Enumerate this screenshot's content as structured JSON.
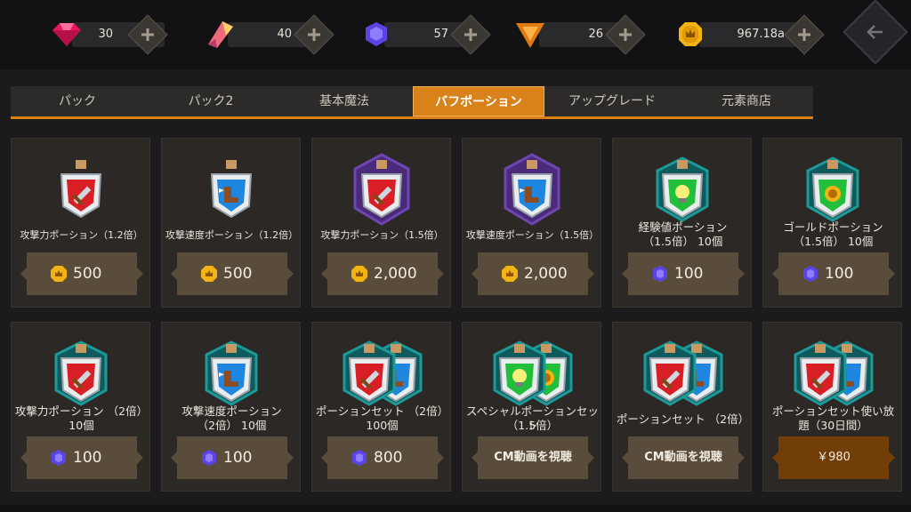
{
  "currencies": [
    {
      "icon": "ruby-gem-icon",
      "value": "30"
    },
    {
      "icon": "pink-crystal-icon",
      "value": "40"
    },
    {
      "icon": "purple-gem-icon",
      "value": "57"
    },
    {
      "icon": "orange-triangle-gem-icon",
      "value": "26"
    },
    {
      "icon": "gold-coin-icon",
      "value": "967.18a"
    }
  ],
  "tabs": [
    {
      "label": "パック",
      "active": false
    },
    {
      "label": "パック2",
      "active": false
    },
    {
      "label": "基本魔法",
      "active": false
    },
    {
      "label": "バフポーション",
      "active": true
    },
    {
      "label": "アップグレード",
      "active": false
    },
    {
      "label": "元素商店",
      "active": false
    }
  ],
  "colors": {
    "accent": "#d8821a",
    "card": "#2b2825",
    "button": "#594c3b",
    "buy_button": "#713e07"
  },
  "cards": [
    {
      "name_lines": [
        "攻撃力ポーション（1.2倍）"
      ],
      "potions": "sword-red",
      "frame": "none",
      "price_icon": "gold-coin-icon",
      "price": "500"
    },
    {
      "name_lines": [
        "攻撃速度ポーション（1.2倍）"
      ],
      "potions": "boot-blue",
      "frame": "none",
      "price_icon": "gold-coin-icon",
      "price": "500"
    },
    {
      "name_lines": [
        "攻撃力ポーション（1.5倍）"
      ],
      "potions": "sword-red",
      "frame": "purple",
      "price_icon": "gold-coin-icon",
      "price": "2,000"
    },
    {
      "name_lines": [
        "攻撃速度ポーション（1.5倍）"
      ],
      "potions": "boot-blue",
      "frame": "purple",
      "price_icon": "gold-coin-icon",
      "price": "2,000"
    },
    {
      "name_lines": [
        "経験値ポーション",
        "（1.5倍） 10個"
      ],
      "potions": "bulb-green",
      "frame": "teal",
      "price_icon": "purple-gem-icon",
      "price": "100"
    },
    {
      "name_lines": [
        "ゴールドポーション",
        "（1.5倍） 10個"
      ],
      "potions": "coin-green",
      "frame": "teal",
      "price_icon": "purple-gem-icon",
      "price": "100"
    },
    {
      "name_lines": [
        "攻撃力ポーション （2倍）",
        "10個"
      ],
      "potions": "sword-red",
      "frame": "teal",
      "price_icon": "purple-gem-icon",
      "price": "100"
    },
    {
      "name_lines": [
        "攻撃速度ポーション",
        "（2倍） 10個"
      ],
      "potions": "boot-blue",
      "frame": "teal",
      "price_icon": "purple-gem-icon",
      "price": "100"
    },
    {
      "name_lines": [
        "ポーションセット （2倍）",
        "100個"
      ],
      "potions": "set-sword-boot",
      "frame": "teal",
      "price_icon": "purple-gem-icon",
      "price": "800"
    },
    {
      "name_lines": [
        "スペシャルポーションセット",
        "（1.5倍）"
      ],
      "potions": "set-bulb-coin",
      "frame": "teal",
      "action": "CM動画を視聴"
    },
    {
      "name_lines": [
        "ポーションセット （2倍）"
      ],
      "potions": "set-sword-boot",
      "frame": "teal",
      "action": "CM動画を視聴"
    },
    {
      "name_lines": [
        "ポーションセット使い放",
        "題（30日間）"
      ],
      "potions": "set-sword-boot",
      "frame": "teal",
      "price": "￥980",
      "buy": true
    }
  ]
}
